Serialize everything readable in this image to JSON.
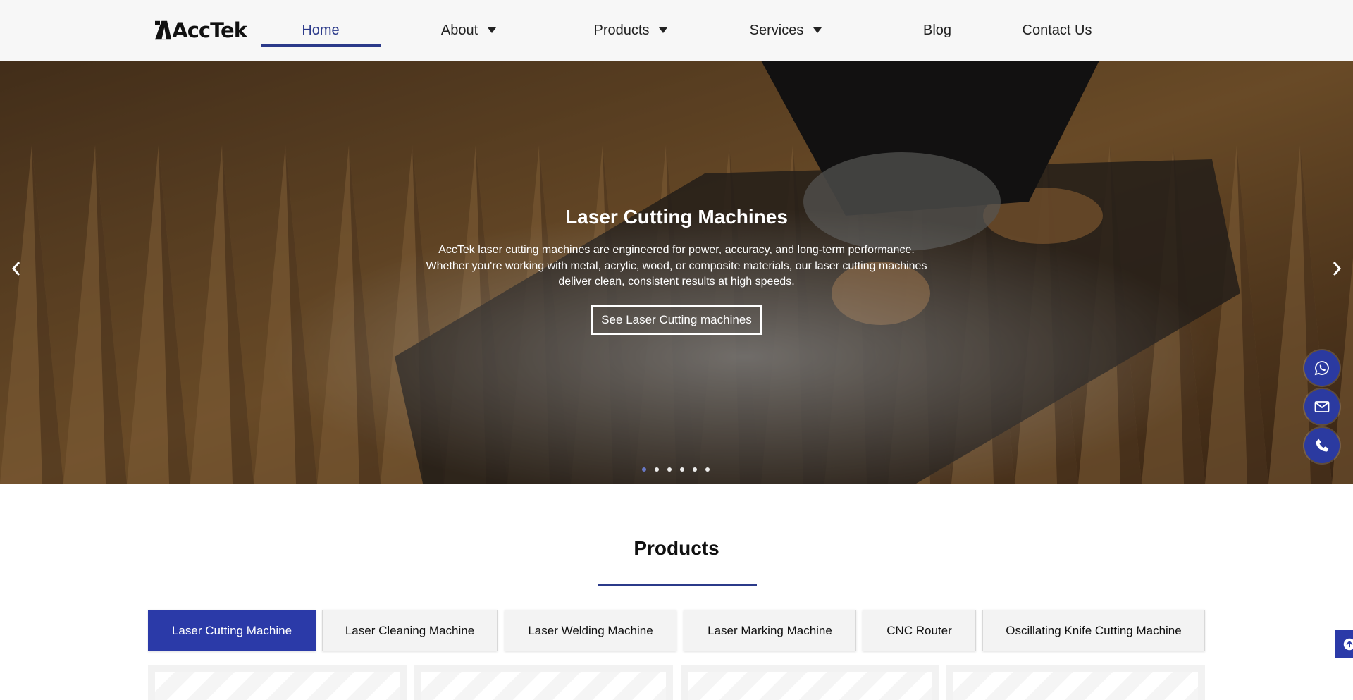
{
  "brand": {
    "name": "AccTek"
  },
  "nav": {
    "items": [
      {
        "label": "Home",
        "active": true,
        "dropdown": false
      },
      {
        "label": "About",
        "active": false,
        "dropdown": true
      },
      {
        "label": "Products",
        "active": false,
        "dropdown": true
      },
      {
        "label": "Services",
        "active": false,
        "dropdown": true
      },
      {
        "label": "Blog",
        "active": false,
        "dropdown": false
      },
      {
        "label": "Contact Us",
        "active": false,
        "dropdown": false
      }
    ]
  },
  "hero": {
    "title": "Laser Cutting Machines",
    "text": "AccTek laser cutting machines are engineered for power, accuracy, and long-term performance. Whether you're working with metal, acrylic, wood, or composite materials, our laser cutting machines deliver clean, consistent results at high speeds.",
    "button": "See Laser Cutting machines",
    "slide_count": 6,
    "active_slide": 1
  },
  "floating": {
    "icons": [
      "whatsapp-icon",
      "mail-icon",
      "phone-icon"
    ]
  },
  "products": {
    "title": "Products",
    "tabs": [
      "Laser Cutting Machine",
      "Laser Cleaning Machine",
      "Laser Welding Machine",
      "Laser Marking Machine",
      "CNC Router",
      "Oscillating Knife Cutting Machine"
    ],
    "active_tab": 0
  },
  "colors": {
    "accent": "#2b3aa8",
    "nav_active": "#2b3a8a",
    "header_bg": "#f7f7f7"
  }
}
